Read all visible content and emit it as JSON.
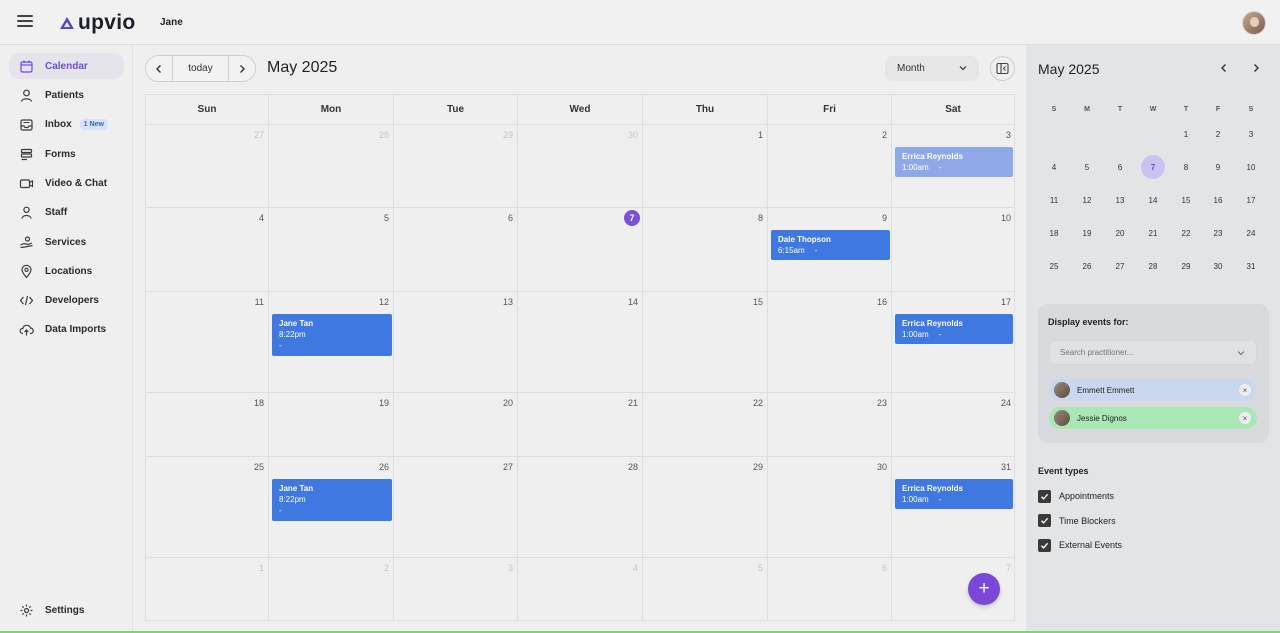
{
  "app": {
    "brand": "upvio",
    "user_name": "Jane",
    "accent": "#6d4ae0",
    "event_color": "#3f78e0"
  },
  "sidebar": {
    "items": [
      {
        "label": "Calendar",
        "icon": "calendar-icon",
        "active": true
      },
      {
        "label": "Patients",
        "icon": "patients-icon"
      },
      {
        "label": "Inbox",
        "icon": "inbox-icon",
        "badge": "1 New"
      },
      {
        "label": "Forms",
        "icon": "forms-icon"
      },
      {
        "label": "Video & Chat",
        "icon": "video-icon"
      },
      {
        "label": "Staff",
        "icon": "staff-icon"
      },
      {
        "label": "Services",
        "icon": "services-icon"
      },
      {
        "label": "Locations",
        "icon": "location-pin-icon"
      },
      {
        "label": "Developers",
        "icon": "code-icon"
      },
      {
        "label": "Data Imports",
        "icon": "cloud-upload-icon"
      }
    ],
    "settings_label": "Settings"
  },
  "calendar": {
    "today_label": "today",
    "title": "May 2025",
    "view": "Month",
    "weekdays": [
      "Sun",
      "Mon",
      "Tue",
      "Wed",
      "Thu",
      "Fri",
      "Sat"
    ],
    "weeks": [
      [
        {
          "d": "27",
          "m": true
        },
        {
          "d": "28",
          "m": true
        },
        {
          "d": "29",
          "m": true
        },
        {
          "d": "30",
          "m": true
        },
        {
          "d": "1"
        },
        {
          "d": "2"
        },
        {
          "d": "3"
        }
      ],
      [
        {
          "d": "4"
        },
        {
          "d": "5"
        },
        {
          "d": "6"
        },
        {
          "d": "7",
          "today": true
        },
        {
          "d": "8"
        },
        {
          "d": "9"
        },
        {
          "d": "10"
        }
      ],
      [
        {
          "d": "11"
        },
        {
          "d": "12"
        },
        {
          "d": "13"
        },
        {
          "d": "14"
        },
        {
          "d": "15"
        },
        {
          "d": "16"
        },
        {
          "d": "17"
        }
      ],
      [
        {
          "d": "18"
        },
        {
          "d": "19"
        },
        {
          "d": "20"
        },
        {
          "d": "21"
        },
        {
          "d": "22"
        },
        {
          "d": "23"
        },
        {
          "d": "24"
        }
      ],
      [
        {
          "d": "25"
        },
        {
          "d": "26"
        },
        {
          "d": "27"
        },
        {
          "d": "28"
        },
        {
          "d": "29"
        },
        {
          "d": "30"
        },
        {
          "d": "31"
        }
      ],
      [
        {
          "d": "1",
          "m": true
        },
        {
          "d": "2",
          "m": true
        },
        {
          "d": "3",
          "m": true
        },
        {
          "d": "4",
          "m": true
        },
        {
          "d": "5",
          "m": true
        },
        {
          "d": "6",
          "m": true
        },
        {
          "d": "7",
          "m": true
        }
      ]
    ],
    "events": [
      {
        "week": 0,
        "day": 6,
        "name": "Errica Reynolds",
        "time": "1:00am",
        "extra": "-",
        "inline": true,
        "light": true
      },
      {
        "week": 1,
        "day": 5,
        "name": "Dale Thopson",
        "time": "6:15am",
        "extra": "-",
        "inline": true
      },
      {
        "week": 2,
        "day": 1,
        "name": "Jane Tan",
        "time": "8:22pm",
        "extra": "-",
        "inline": false
      },
      {
        "week": 2,
        "day": 6,
        "name": "Errica Reynolds",
        "time": "1:00am",
        "extra": "-",
        "inline": true
      },
      {
        "week": 4,
        "day": 1,
        "name": "Jane Tan",
        "time": "8:22pm",
        "extra": "-",
        "inline": false
      },
      {
        "week": 4,
        "day": 6,
        "name": "Errica Reynolds",
        "time": "1:00am",
        "extra": "-",
        "inline": true
      }
    ],
    "add_label": "+"
  },
  "mini_calendar": {
    "title": "May 2025",
    "weekdays": [
      "S",
      "M",
      "T",
      "W",
      "T",
      "F",
      "S"
    ],
    "weeks": [
      [
        "",
        "",
        "",
        "",
        "1",
        "2",
        "3"
      ],
      [
        "4",
        "5",
        "6",
        "7",
        "8",
        "9",
        "10"
      ],
      [
        "11",
        "12",
        "13",
        "14",
        "15",
        "16",
        "17"
      ],
      [
        "18",
        "19",
        "20",
        "21",
        "22",
        "23",
        "24"
      ],
      [
        "25",
        "26",
        "27",
        "28",
        "29",
        "30",
        "31"
      ]
    ],
    "selected": "7"
  },
  "filters": {
    "label": "Display events for:",
    "placeholder": "Search practitioner...",
    "practitioners": [
      {
        "name": "Emmett Emmett",
        "color": "#c9d8ef"
      },
      {
        "name": "Jessie Dignos",
        "color": "#a9e8b5"
      }
    ]
  },
  "event_types": {
    "title": "Event types",
    "items": [
      "Appointments",
      "Time Blockers",
      "External Events"
    ]
  }
}
